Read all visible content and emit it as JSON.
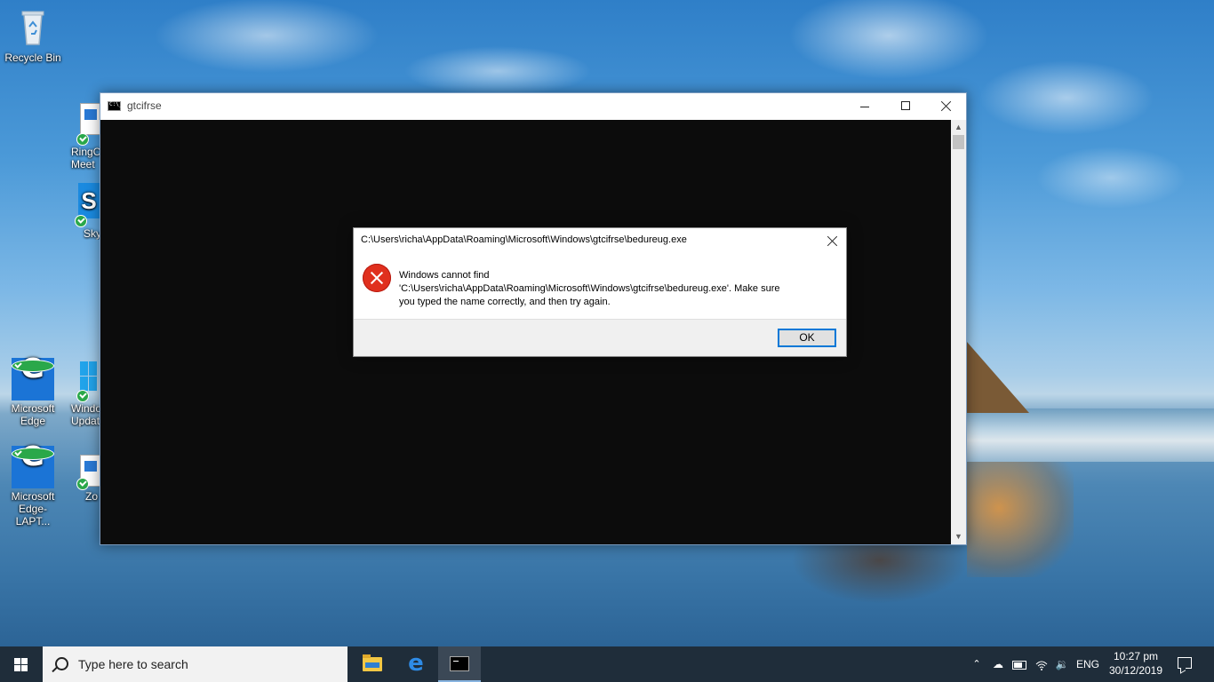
{
  "desktop": {
    "icons": [
      {
        "label": "Recycle Bin"
      },
      {
        "label": "RingC Meet"
      },
      {
        "label": "Sky"
      },
      {
        "label": "Microsoft Edge"
      },
      {
        "label": "Windo Updat"
      },
      {
        "label": "Microsoft Edge-LAPT..."
      },
      {
        "label": "Zo"
      }
    ]
  },
  "console": {
    "title": "gtcifrse",
    "icon": "cmd-icon"
  },
  "dialog": {
    "title": "C:\\Users\\richa\\AppData\\Roaming\\Microsoft\\Windows\\gtcifrse\\bedureug.exe",
    "message_line1": "Windows cannot find",
    "message_line2": "'C:\\Users\\richa\\AppData\\Roaming\\Microsoft\\Windows\\gtcifrse\\bedureug.exe'. Make sure",
    "message_line3": "you typed the name correctly, and then try again.",
    "ok_label": "OK",
    "icon": "error-icon",
    "accent_color": "#0078d7",
    "error_color": "#e0301e"
  },
  "taskbar": {
    "search_placeholder": "Type here to search",
    "apps": [
      "file-explorer",
      "microsoft-edge",
      "command-prompt"
    ],
    "tray": {
      "language": "ENG",
      "time": "10:27 pm",
      "date": "30/12/2019"
    },
    "background_color": "#1f2d3a"
  }
}
